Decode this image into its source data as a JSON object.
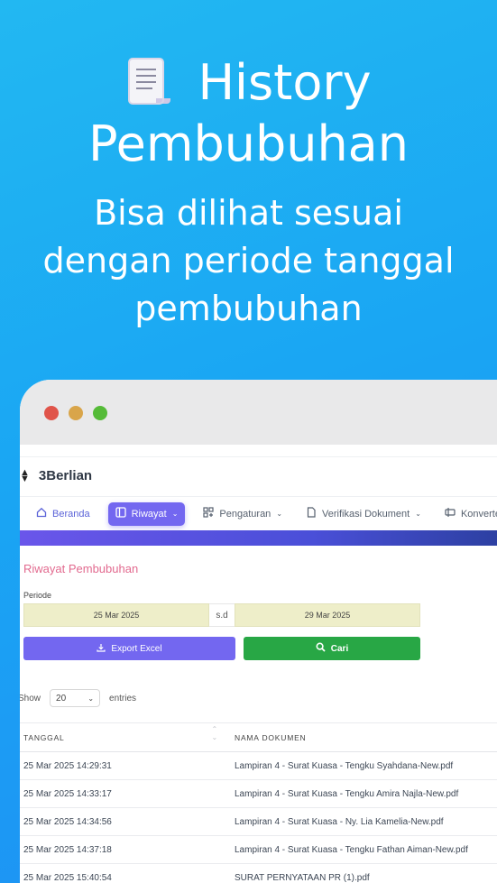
{
  "hero": {
    "title_line1": "History",
    "title_line2": "Pembubuhan",
    "subtitle_lines": [
      "Bisa dilihat sesuai",
      "dengan periode tanggal",
      "pembubuhan"
    ],
    "icon": "document-scroll-icon"
  },
  "window": {
    "brand": "3Berlian",
    "nav": [
      {
        "label": "Beranda",
        "icon": "home-icon"
      },
      {
        "label": "Riwayat",
        "icon": "layout-icon"
      },
      {
        "label": "Pengaturan",
        "icon": "apps-icon"
      },
      {
        "label": "Verifikasi Dokument",
        "icon": "file-icon"
      },
      {
        "label": "Konverter",
        "icon": "convert-icon"
      }
    ],
    "page_title": "Riwayat Pembubuhan",
    "period_label": "Periode",
    "date_from": "25 Mar 2025",
    "date_sep": "s.d",
    "date_to": "29 Mar 2025",
    "export_label": "Export Excel",
    "search_label": "Cari",
    "show_label": "Show",
    "entries_value": "20",
    "entries_label": "entries",
    "columns": [
      "TANGGAL",
      "NAMA DOKUMEN"
    ],
    "rows": [
      {
        "tanggal": "25 Mar 2025 14:29:31",
        "nama": "Lampiran 4 - Surat Kuasa - Tengku Syahdana-New.pdf"
      },
      {
        "tanggal": "25 Mar 2025 14:33:17",
        "nama": "Lampiran 4 - Surat Kuasa - Tengku Amira Najla-New.pdf"
      },
      {
        "tanggal": "25 Mar 2025 14:34:56",
        "nama": "Lampiran 4 - Surat Kuasa - Ny. Lia Kamelia-New.pdf"
      },
      {
        "tanggal": "25 Mar 2025 14:37:18",
        "nama": "Lampiran 4 - Surat Kuasa - Tengku Fathan Aiman-New.pdf"
      },
      {
        "tanggal": "25 Mar 2025 15:40:54",
        "nama": "SURAT PERNYATAAN PR (1).pdf"
      }
    ]
  },
  "colors": {
    "accent": "#7367f0",
    "success": "#28a745",
    "title_pink": "#e26a8f"
  }
}
